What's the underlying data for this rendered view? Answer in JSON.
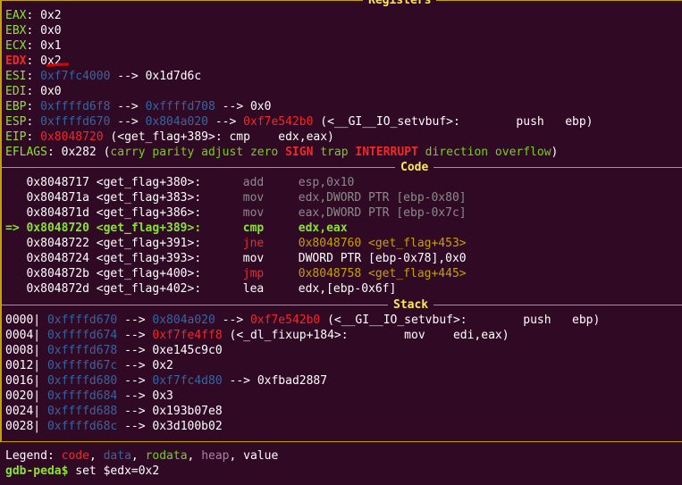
{
  "registers": {
    "title": "Registers",
    "eax": {
      "name": "EAX",
      "val": "0x2"
    },
    "ebx": {
      "name": "EBX",
      "val": "0x0"
    },
    "ecx": {
      "name": "ECX",
      "val": "0x1"
    },
    "edx": {
      "name": "EDX",
      "val": "0x2"
    },
    "esi": {
      "name": "ESI",
      "p1": "0xf7fc4000",
      "a1": " --> ",
      "v": "0x1d7d6c"
    },
    "edi": {
      "name": "EDI",
      "val": "0x0"
    },
    "ebp": {
      "name": "EBP",
      "p1": "0xffffd6f8",
      "a1": " --> ",
      "p2": "0xffffd708",
      "a2": " --> ",
      "v": "0x0"
    },
    "esp": {
      "name": "ESP",
      "p1": "0xffffd670",
      "a1": " --> ",
      "p2": "0x804a020",
      "a2": " --> ",
      "p3": "0xf7e542b0",
      "rest": " (<__GI__IO_setvbuf>:        push   ebp)"
    },
    "eip": {
      "name": "EIP",
      "addr": "0x8048720",
      "rest": " (<get_flag+389>: cmp    edx,eax)"
    },
    "eflags": {
      "name": "EFLAGS",
      "val": "0x282",
      "open": " (",
      "f1": "carry parity adjust zero ",
      "sign": "SIGN",
      "f2": " trap ",
      "intr": "INTERRUPT",
      "f3": " direction overflow",
      "close": ")"
    }
  },
  "code": {
    "title": "Code",
    "lines": [
      {
        "prefix": "   ",
        "addr": "0x8048717",
        "sym": "<get_flag+380>:",
        "mn": "add",
        "op": "esp,0x10",
        "cls": "n"
      },
      {
        "prefix": "   ",
        "addr": "0x804871a",
        "sym": "<get_flag+383>:",
        "mn": "mov",
        "op": "edx,DWORD PTR [ebp-0x80]",
        "cls": "n"
      },
      {
        "prefix": "   ",
        "addr": "0x804871d",
        "sym": "<get_flag+386>:",
        "mn": "mov",
        "op": "eax,DWORD PTR [ebp-0x7c]",
        "cls": "n"
      },
      {
        "prefix": "=> ",
        "addr": "0x8048720",
        "sym": "<get_flag+389>:",
        "mn": "cmp",
        "op": "edx,eax",
        "cls": "cur"
      },
      {
        "prefix": "   ",
        "addr": "0x8048722",
        "sym": "<get_flag+391>:",
        "mn": "jne",
        "op": "0x8048760 <get_flag+453>",
        "cls": "j"
      },
      {
        "prefix": "   ",
        "addr": "0x8048724",
        "sym": "<get_flag+393>:",
        "mn": "mov",
        "op": "DWORD PTR [ebp-0x78],0x0",
        "cls": "a"
      },
      {
        "prefix": "   ",
        "addr": "0x804872b",
        "sym": "<get_flag+400>:",
        "mn": "jmp",
        "op": "0x8048758 <get_flag+445>",
        "cls": "j"
      },
      {
        "prefix": "   ",
        "addr": "0x804872d",
        "sym": "<get_flag+402>:",
        "mn": "lea",
        "op": "edx,[ebp-0x6f]",
        "cls": "a"
      }
    ]
  },
  "stack": {
    "title": "Stack",
    "rows": [
      {
        "idx": "0000|",
        "a": "0xffffd670",
        "r1": " --> ",
        "p2": "0x804a020",
        "r2": " --> ",
        "p3": "0xf7e542b0",
        "rest": " (<__GI__IO_setvbuf>:        push   ebp)"
      },
      {
        "idx": "0004|",
        "a": "0xffffd674",
        "r1": " --> ",
        "p3": "0xf7fe4ff8",
        "rest": " (<_dl_fixup+184>:        mov    edi,eax)"
      },
      {
        "idx": "0008|",
        "a": "0xffffd678",
        "r1": " --> ",
        "v": "0xe145c9c0"
      },
      {
        "idx": "0012|",
        "a": "0xffffd67c",
        "r1": " --> ",
        "v": "0x2"
      },
      {
        "idx": "0016|",
        "a": "0xffffd680",
        "r1": " --> ",
        "p2": "0xf7fc4d80",
        "r2": " --> ",
        "v": "0xfbad2887"
      },
      {
        "idx": "0020|",
        "a": "0xffffd684",
        "r1": " --> ",
        "v": "0x3"
      },
      {
        "idx": "0024|",
        "a": "0xffffd688",
        "r1": " --> ",
        "v": "0x193b07e8"
      },
      {
        "idx": "0028|",
        "a": "0xffffd68c",
        "r1": " --> ",
        "v": "0x3d100b02"
      }
    ]
  },
  "legend": {
    "label": "Legend: ",
    "code": "code",
    "c1": ", ",
    "data": "data",
    "c2": ", ",
    "rodata": "rodata",
    "c3": ", ",
    "heap": "heap",
    "c4": ", ",
    "value": "value"
  },
  "prompt": {
    "text": "gdb-peda$",
    "command": " set $edx=0x2"
  },
  "colors": {
    "background": "#300a24",
    "separator": "#c4a000",
    "register_name": "#8ae234",
    "pointer": "#3465a4",
    "code_ptr": "#ef2929",
    "annotation": "#e00000"
  }
}
